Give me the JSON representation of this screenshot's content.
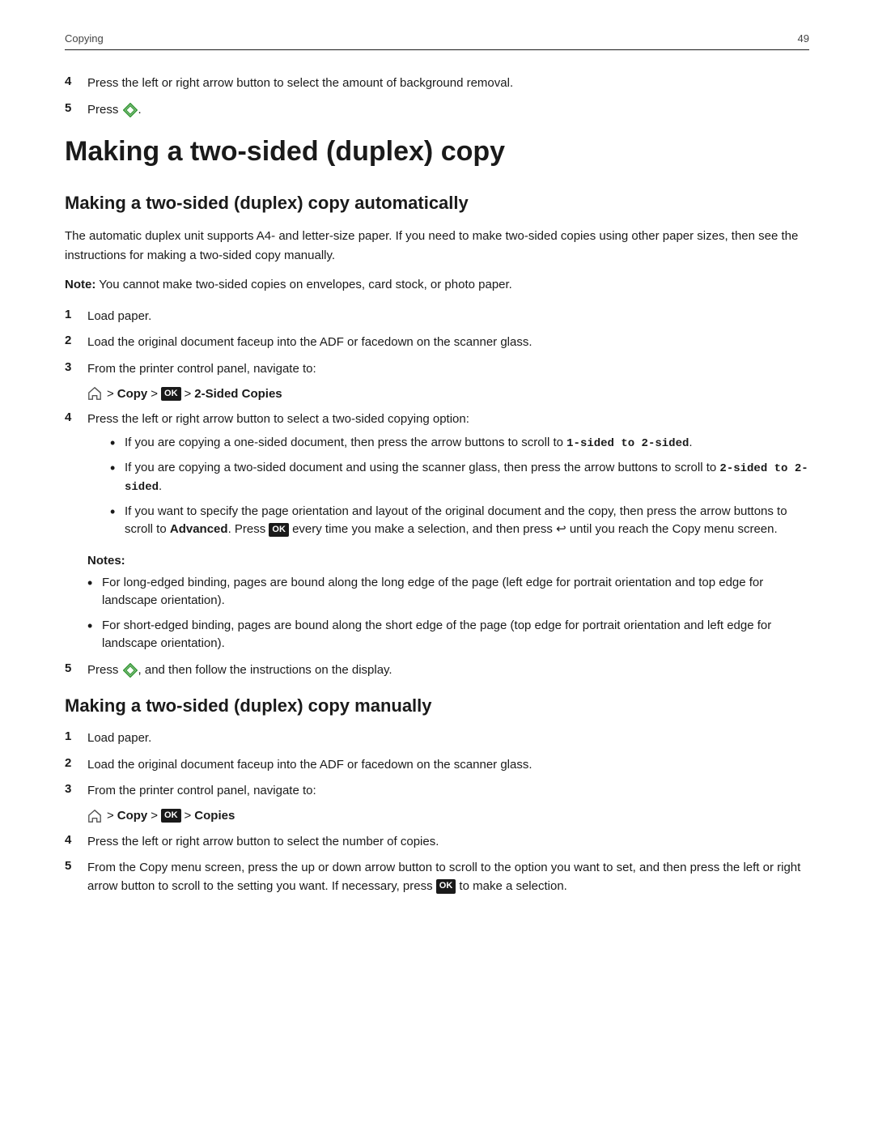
{
  "header": {
    "section": "Copying",
    "page_number": "49"
  },
  "intro_steps": [
    {
      "number": "4",
      "text": "Press the left or right arrow button to select the amount of background removal."
    },
    {
      "number": "5",
      "text": "Press",
      "has_diamond": true
    }
  ],
  "main_title": "Making a two-sided (duplex) copy",
  "auto_section": {
    "title": "Making a two-sided (duplex) copy automatically",
    "description": "The automatic duplex unit supports A4- and letter-size paper. If you need to make two-sided copies using other paper sizes, then see the instructions for making a two-sided copy manually.",
    "note": "You cannot make two-sided copies on envelopes, card stock, or photo paper.",
    "steps": [
      {
        "number": "1",
        "text": "Load paper."
      },
      {
        "number": "2",
        "text": "Load the original document faceup into the ADF or facedown on the scanner glass."
      },
      {
        "number": "3",
        "text": "From the printer control panel, navigate to:",
        "nav": {
          "copy_label": "Copy",
          "ok_badge": "OK",
          "menu_label": "2-Sided Copies"
        }
      },
      {
        "number": "4",
        "text": "Press the left or right arrow button to select a two-sided copying option:",
        "bullets": [
          {
            "text_before": "If you are copying a one-sided document, then press the arrow buttons to scroll to ",
            "code": "1-sided to 2-sided",
            "text_after": "."
          },
          {
            "text_before": "If you are copying a two-sided document and using the scanner glass, then press the arrow buttons to scroll to ",
            "code": "2-sided to 2-sided",
            "text_after": "."
          },
          {
            "text_before": "If you want to specify the page orientation and layout of the original document and the copy, then press the arrow buttons to scroll to ",
            "bold": "Advanced",
            "text_middle": ". Press ",
            "ok_badge": "OK",
            "text_after": " every time you make a selection, and then press",
            "back_arrow": true,
            "text_end": " until you reach the Copy menu screen."
          }
        ]
      }
    ],
    "notes_label": "Notes:",
    "notes": [
      "For long-edged binding, pages are bound along the long edge of the page (left edge for portrait orientation and top edge for landscape orientation).",
      "For short-edged binding, pages are bound along the short edge of the page (top edge for portrait orientation and left edge for landscape orientation)."
    ],
    "final_step": {
      "number": "5",
      "text_before": "Press",
      "has_diamond": true,
      "text_after": ", and then follow the instructions on the display."
    }
  },
  "manual_section": {
    "title": "Making a two-sided (duplex) copy manually",
    "steps": [
      {
        "number": "1",
        "text": "Load paper."
      },
      {
        "number": "2",
        "text": "Load the original document faceup into the ADF or facedown on the scanner glass."
      },
      {
        "number": "3",
        "text": "From the printer control panel, navigate to:",
        "nav": {
          "copy_label": "Copy",
          "ok_badge": "OK",
          "menu_label": "Copies"
        }
      },
      {
        "number": "4",
        "text": "Press the left or right arrow button to select the number of copies."
      },
      {
        "number": "5",
        "text_before": "From the Copy menu screen, press the up or down arrow button to scroll to the option you want to set, and then press the left or right arrow button to scroll to the setting you want. If necessary, press ",
        "ok_badge": "OK",
        "text_after": " to make a selection."
      }
    ]
  },
  "labels": {
    "note_prefix": "Note:",
    "notes_prefix": "Notes:",
    "arrow": ">",
    "ok_text": "OK",
    "back_text": "↩"
  }
}
